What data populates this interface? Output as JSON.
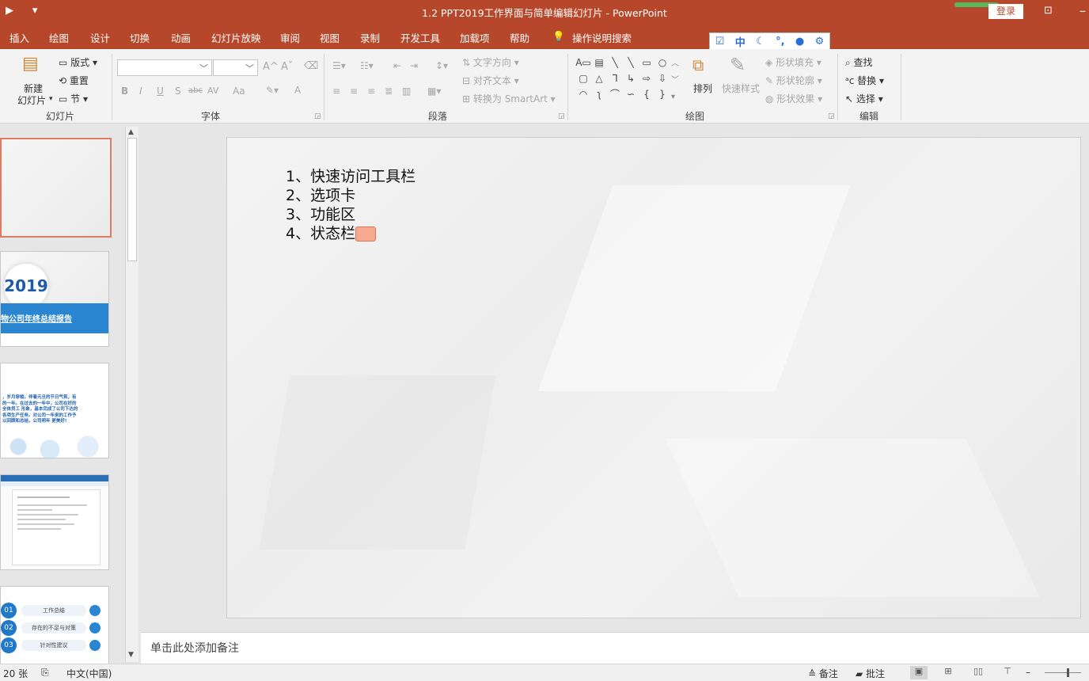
{
  "window": {
    "title": "1.2 PPT2019工作界面与简单编辑幻灯片  -  PowerPoint",
    "login_label": "登录"
  },
  "quick_access": {
    "icons": [
      "slideshow-from-start-icon",
      "customize-qat-icon"
    ]
  },
  "tabs": [
    "插入",
    "绘图",
    "设计",
    "切换",
    "动画",
    "幻灯片放映",
    "审阅",
    "视图",
    "录制",
    "开发工具",
    "加载项",
    "帮助"
  ],
  "tell_me": "操作说明搜索",
  "ime_bar": {
    "mode_label": "中",
    "icons": [
      "ime-logo-icon",
      "moon-icon",
      "punctuation-icon",
      "user-icon",
      "gear-icon"
    ]
  },
  "ribbon": {
    "slides": {
      "label": "幻灯片",
      "new_slide": "新建",
      "new_slide_2": "幻灯片",
      "layout": "版式",
      "reset": "重置",
      "section": "节"
    },
    "font": {
      "label": "字体",
      "buttons": [
        "B",
        "I",
        "U",
        "S",
        "abc",
        "AV",
        "Aa",
        "A"
      ]
    },
    "paragraph": {
      "label": "段落",
      "text_direction": "文字方向",
      "align_text": "对齐文本",
      "smartart": "转换为 SmartArt"
    },
    "drawing": {
      "label": "绘图",
      "arrange": "排列",
      "quick_styles": "快速样式",
      "shape_fill": "形状填充",
      "shape_outline": "形状轮廓",
      "shape_effects": "形状效果"
    },
    "editing": {
      "label": "编辑",
      "find": "查找",
      "replace": "替换",
      "select": "选择"
    }
  },
  "thumbnails": {
    "t2_year": "2019",
    "t2_title": "物公司年终总结报告",
    "t3_text": "，岁月穿梭。伴着元旦的节日气氛，有的一年。在过去的一年中，公司在好的全体员工 形象，基本完成了公司下达的各项生产任务。对公司一年来的工作予以回顾和总结，公司明年 更美好!",
    "t5_items": [
      {
        "num": "01",
        "label": "工作总结"
      },
      {
        "num": "02",
        "label": "存在的不足与对策"
      },
      {
        "num": "03",
        "label": "针对性建议"
      }
    ]
  },
  "slide": {
    "lines": [
      "1、快速访问工具栏",
      "2、选项卡",
      "3、功能区",
      "4、状态栏"
    ]
  },
  "notes": {
    "placeholder": "单击此处添加备注"
  },
  "status": {
    "slide_count": "20 张",
    "language": "中文(中国)",
    "notes_label": "备注",
    "comments_label": "批注"
  }
}
